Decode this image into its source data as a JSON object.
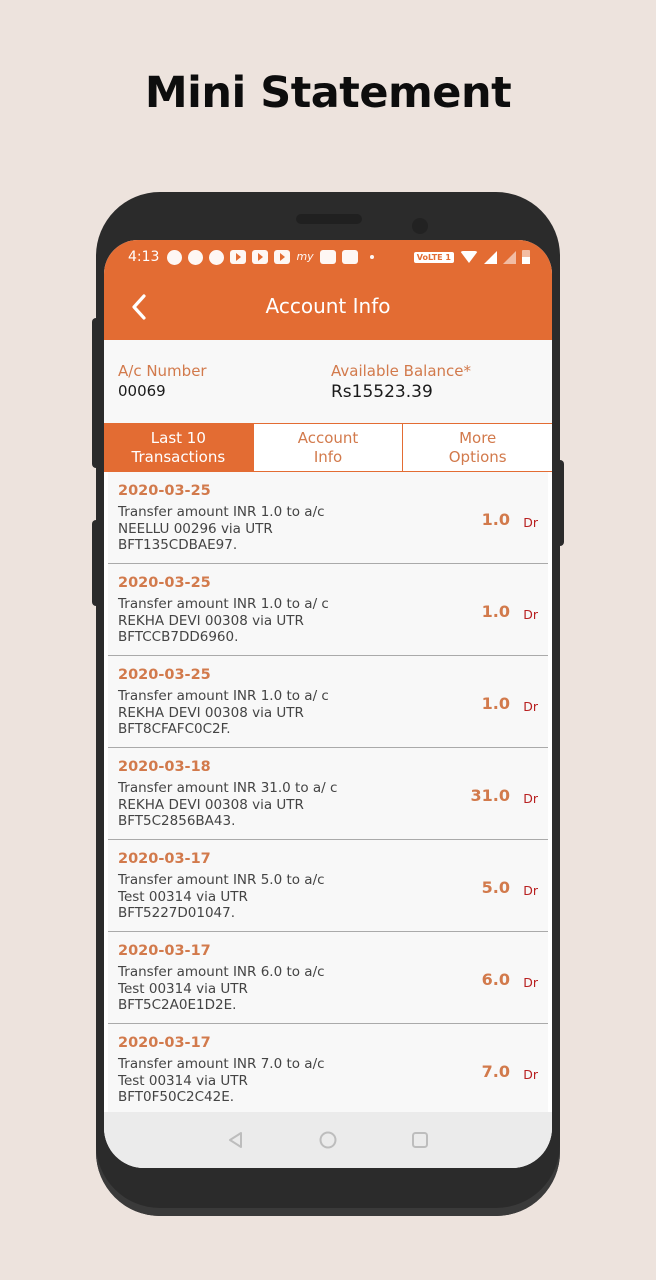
{
  "headline": "Mini Statement",
  "status_bar": {
    "time": "4:13",
    "notification_icons": [
      "whatsapp-icon",
      "chat-bubble-icon",
      "messenger-icon",
      "video-icon",
      "video-icon",
      "video-icon",
      "myntra-icon",
      "clapper-icon",
      "news-icon"
    ],
    "network_label": "VoLTE 1",
    "battery_level": 0.5
  },
  "app_bar": {
    "title": "Account Info",
    "back_icon": "chevron-left-icon"
  },
  "account": {
    "number_label": "A/c Number",
    "number_value": "00069",
    "balance_label": "Available Balance*",
    "balance_value": "Rs15523.39"
  },
  "tabs": [
    {
      "label": "Last 10\nTransactions",
      "active": true
    },
    {
      "label": "Account\nInfo",
      "active": false
    },
    {
      "label": "More\nOptions",
      "active": false
    }
  ],
  "transactions": [
    {
      "date": "2020-03-25",
      "description": "Transfer amount INR 1.0 to a/c NEELLU 00296 via UTR BFT135CDBAE97.",
      "amount": "1.0",
      "type": "Dr"
    },
    {
      "date": "2020-03-25",
      "description": "Transfer amount INR 1.0 to a/ c REKHA DEVI 00308 via UTR BFTCCB7DD6960.",
      "amount": "1.0",
      "type": "Dr"
    },
    {
      "date": "2020-03-25",
      "description": "Transfer amount INR 1.0 to a/ c REKHA DEVI 00308 via UTR BFT8CFAFC0C2F.",
      "amount": "1.0",
      "type": "Dr"
    },
    {
      "date": "2020-03-18",
      "description": "Transfer amount INR 31.0 to a/ c REKHA DEVI 00308 via UTR BFT5C2856BA43.",
      "amount": "31.0",
      "type": "Dr"
    },
    {
      "date": "2020-03-17",
      "description": "Transfer amount INR 5.0 to a/c Test 00314 via UTR BFT5227D01047.",
      "amount": "5.0",
      "type": "Dr"
    },
    {
      "date": "2020-03-17",
      "description": "Transfer amount INR 6.0 to a/c Test 00314 via UTR BFT5C2A0E1D2E.",
      "amount": "6.0",
      "type": "Dr"
    },
    {
      "date": "2020-03-17",
      "description": "Transfer amount INR 7.0 to a/c Test 00314 via UTR BFT0F50C2C42E.",
      "amount": "7.0",
      "type": "Dr"
    }
  ],
  "nav_bar": {
    "back": "back-triangle-icon",
    "home": "home-circle-icon",
    "recents": "recents-square-icon"
  },
  "colors": {
    "accent": "#e36c33",
    "label": "#d27a4c",
    "debit": "#b81f1f",
    "background": "#ede3dd",
    "frame": "#2b2b2b"
  }
}
